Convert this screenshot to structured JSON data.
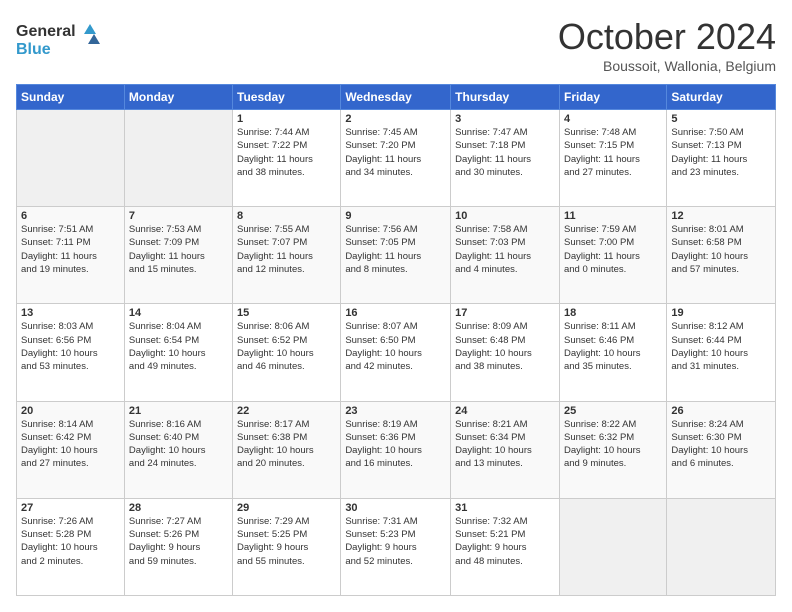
{
  "header": {
    "logo_line1": "General",
    "logo_line2": "Blue",
    "month_title": "October 2024",
    "location": "Boussoit, Wallonia, Belgium"
  },
  "calendar": {
    "days_of_week": [
      "Sunday",
      "Monday",
      "Tuesday",
      "Wednesday",
      "Thursday",
      "Friday",
      "Saturday"
    ],
    "weeks": [
      [
        {
          "day": "",
          "info": ""
        },
        {
          "day": "",
          "info": ""
        },
        {
          "day": "1",
          "info": "Sunrise: 7:44 AM\nSunset: 7:22 PM\nDaylight: 11 hours\nand 38 minutes."
        },
        {
          "day": "2",
          "info": "Sunrise: 7:45 AM\nSunset: 7:20 PM\nDaylight: 11 hours\nand 34 minutes."
        },
        {
          "day": "3",
          "info": "Sunrise: 7:47 AM\nSunset: 7:18 PM\nDaylight: 11 hours\nand 30 minutes."
        },
        {
          "day": "4",
          "info": "Sunrise: 7:48 AM\nSunset: 7:15 PM\nDaylight: 11 hours\nand 27 minutes."
        },
        {
          "day": "5",
          "info": "Sunrise: 7:50 AM\nSunset: 7:13 PM\nDaylight: 11 hours\nand 23 minutes."
        }
      ],
      [
        {
          "day": "6",
          "info": "Sunrise: 7:51 AM\nSunset: 7:11 PM\nDaylight: 11 hours\nand 19 minutes."
        },
        {
          "day": "7",
          "info": "Sunrise: 7:53 AM\nSunset: 7:09 PM\nDaylight: 11 hours\nand 15 minutes."
        },
        {
          "day": "8",
          "info": "Sunrise: 7:55 AM\nSunset: 7:07 PM\nDaylight: 11 hours\nand 12 minutes."
        },
        {
          "day": "9",
          "info": "Sunrise: 7:56 AM\nSunset: 7:05 PM\nDaylight: 11 hours\nand 8 minutes."
        },
        {
          "day": "10",
          "info": "Sunrise: 7:58 AM\nSunset: 7:03 PM\nDaylight: 11 hours\nand 4 minutes."
        },
        {
          "day": "11",
          "info": "Sunrise: 7:59 AM\nSunset: 7:00 PM\nDaylight: 11 hours\nand 0 minutes."
        },
        {
          "day": "12",
          "info": "Sunrise: 8:01 AM\nSunset: 6:58 PM\nDaylight: 10 hours\nand 57 minutes."
        }
      ],
      [
        {
          "day": "13",
          "info": "Sunrise: 8:03 AM\nSunset: 6:56 PM\nDaylight: 10 hours\nand 53 minutes."
        },
        {
          "day": "14",
          "info": "Sunrise: 8:04 AM\nSunset: 6:54 PM\nDaylight: 10 hours\nand 49 minutes."
        },
        {
          "day": "15",
          "info": "Sunrise: 8:06 AM\nSunset: 6:52 PM\nDaylight: 10 hours\nand 46 minutes."
        },
        {
          "day": "16",
          "info": "Sunrise: 8:07 AM\nSunset: 6:50 PM\nDaylight: 10 hours\nand 42 minutes."
        },
        {
          "day": "17",
          "info": "Sunrise: 8:09 AM\nSunset: 6:48 PM\nDaylight: 10 hours\nand 38 minutes."
        },
        {
          "day": "18",
          "info": "Sunrise: 8:11 AM\nSunset: 6:46 PM\nDaylight: 10 hours\nand 35 minutes."
        },
        {
          "day": "19",
          "info": "Sunrise: 8:12 AM\nSunset: 6:44 PM\nDaylight: 10 hours\nand 31 minutes."
        }
      ],
      [
        {
          "day": "20",
          "info": "Sunrise: 8:14 AM\nSunset: 6:42 PM\nDaylight: 10 hours\nand 27 minutes."
        },
        {
          "day": "21",
          "info": "Sunrise: 8:16 AM\nSunset: 6:40 PM\nDaylight: 10 hours\nand 24 minutes."
        },
        {
          "day": "22",
          "info": "Sunrise: 8:17 AM\nSunset: 6:38 PM\nDaylight: 10 hours\nand 20 minutes."
        },
        {
          "day": "23",
          "info": "Sunrise: 8:19 AM\nSunset: 6:36 PM\nDaylight: 10 hours\nand 16 minutes."
        },
        {
          "day": "24",
          "info": "Sunrise: 8:21 AM\nSunset: 6:34 PM\nDaylight: 10 hours\nand 13 minutes."
        },
        {
          "day": "25",
          "info": "Sunrise: 8:22 AM\nSunset: 6:32 PM\nDaylight: 10 hours\nand 9 minutes."
        },
        {
          "day": "26",
          "info": "Sunrise: 8:24 AM\nSunset: 6:30 PM\nDaylight: 10 hours\nand 6 minutes."
        }
      ],
      [
        {
          "day": "27",
          "info": "Sunrise: 7:26 AM\nSunset: 5:28 PM\nDaylight: 10 hours\nand 2 minutes."
        },
        {
          "day": "28",
          "info": "Sunrise: 7:27 AM\nSunset: 5:26 PM\nDaylight: 9 hours\nand 59 minutes."
        },
        {
          "day": "29",
          "info": "Sunrise: 7:29 AM\nSunset: 5:25 PM\nDaylight: 9 hours\nand 55 minutes."
        },
        {
          "day": "30",
          "info": "Sunrise: 7:31 AM\nSunset: 5:23 PM\nDaylight: 9 hours\nand 52 minutes."
        },
        {
          "day": "31",
          "info": "Sunrise: 7:32 AM\nSunset: 5:21 PM\nDaylight: 9 hours\nand 48 minutes."
        },
        {
          "day": "",
          "info": ""
        },
        {
          "day": "",
          "info": ""
        }
      ]
    ]
  }
}
